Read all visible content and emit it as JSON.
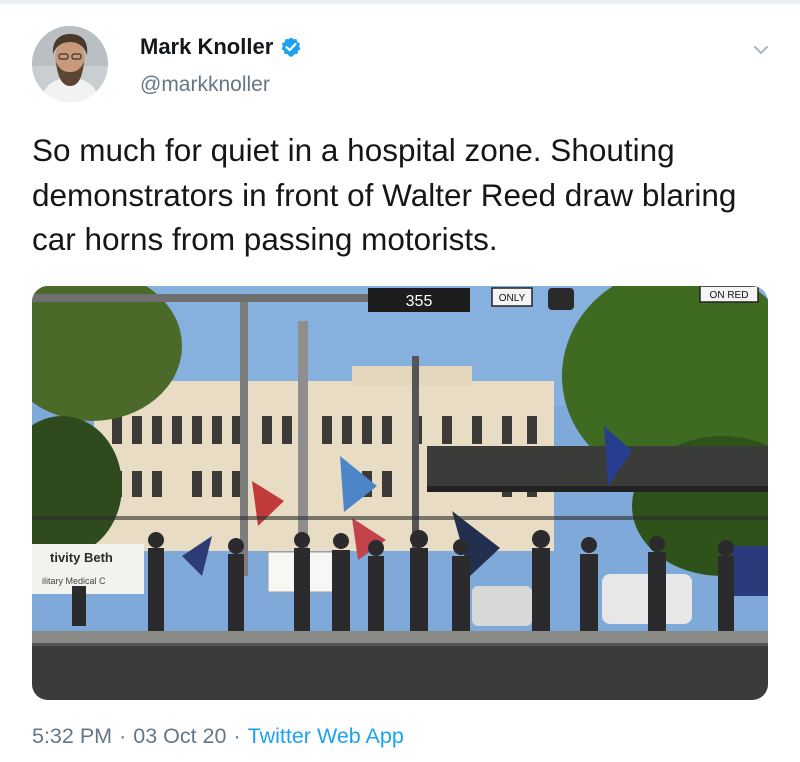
{
  "tweet": {
    "author": {
      "display_name": "Mark Knoller",
      "handle": "@markknoller",
      "verified": true,
      "avatar_icon": "user-avatar"
    },
    "text": "So much for quiet in a hospital zone. Shouting demonstrators in front of Walter Reed draw blaring car horns from passing motorists.",
    "media": {
      "signs": {
        "route_number": "355",
        "only": "ONLY",
        "on_red": "ON RED",
        "banner_left": "tivity Beth",
        "banner_left_sub": "ilitary Medical C"
      }
    },
    "meta": {
      "time": "5:32 PM",
      "date": "03 Oct 20",
      "separator": "·",
      "source": "Twitter Web App"
    },
    "menu_icon": "chevron-down-icon"
  },
  "colors": {
    "text_primary": "#14171a",
    "text_secondary": "#657786",
    "accent": "#1da1f2",
    "verified_badge": "#1da1f2"
  }
}
